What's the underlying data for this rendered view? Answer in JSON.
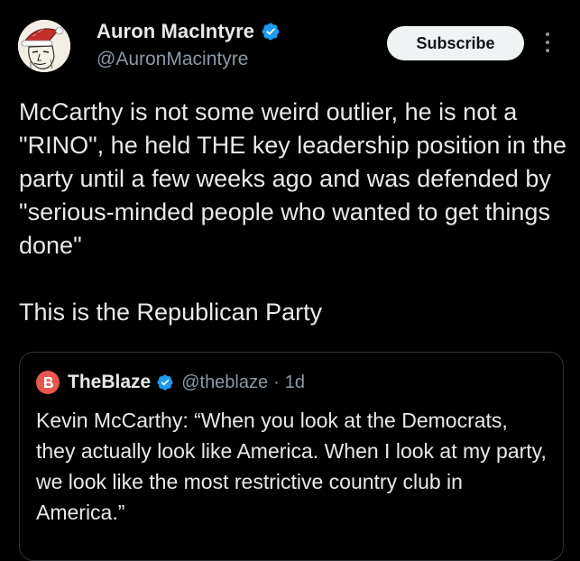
{
  "author": {
    "display_name": "Auron MacIntyre",
    "handle": "@AuronMacintyre",
    "verified_color": "#1d9bf0"
  },
  "actions": {
    "subscribe_label": "Subscribe",
    "more_icon": "more-vertical-icon"
  },
  "tweet": {
    "paragraph_1": "McCarthy is not some weird outlier, he is not a \"RINO\", he held THE key leadership position in the party until a few weeks ago and was defended by \"serious-minded people who wanted to get things done\"",
    "paragraph_2": "This is the Republican Party"
  },
  "quote": {
    "display_name": "TheBlaze",
    "handle": "@theblaze",
    "separator": "·",
    "time": "1d",
    "logo_color": "#e8574d",
    "text": "Kevin McCarthy: “When you look at the Democrats, they actually look like America. When I look at my party, we look like the most restrictive country club in America.”"
  }
}
